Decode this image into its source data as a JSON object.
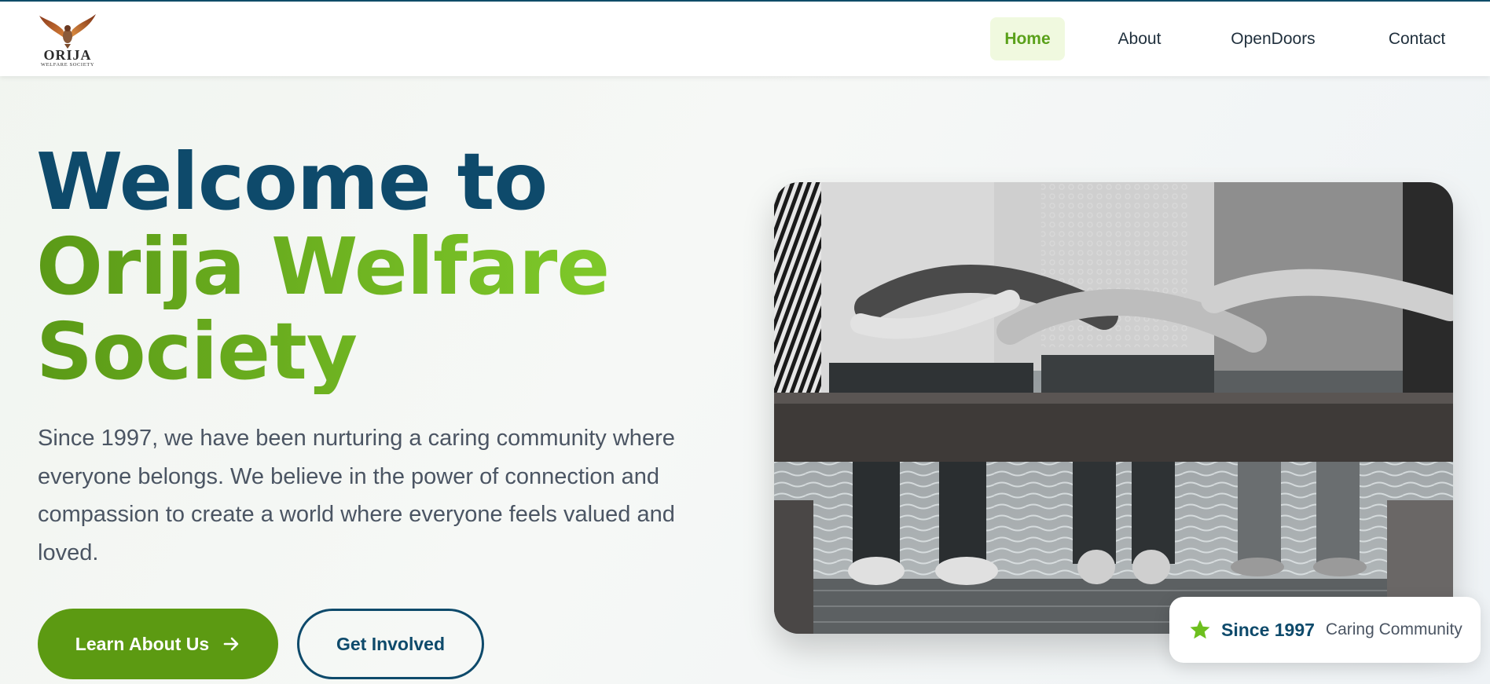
{
  "brand": {
    "logo_word": "ORIJA",
    "logo_sub": "WELFARE SOCIETY"
  },
  "nav": {
    "items": [
      {
        "label": "Home",
        "active": true
      },
      {
        "label": "About",
        "active": false
      },
      {
        "label": "OpenDoors",
        "active": false
      },
      {
        "label": "Contact",
        "active": false
      }
    ]
  },
  "hero": {
    "title_line1": "Welcome to",
    "title_line2": "Orija Welfare",
    "title_line3": "Society",
    "description": "Since 1997, we have been nurturing a caring community where everyone belongs. We believe in the power of connection and compassion to create a world where everyone feels valued and loved.",
    "primary_button": "Learn About Us",
    "secondary_button": "Get Involved"
  },
  "badge": {
    "year": "Since 1997",
    "text": "Caring Community",
    "icon": "star-icon"
  },
  "colors": {
    "navy": "#0e4a6b",
    "green": "#5c9a12",
    "green_light": "#7fc92a",
    "nav_active_bg": "#f0f9df"
  }
}
